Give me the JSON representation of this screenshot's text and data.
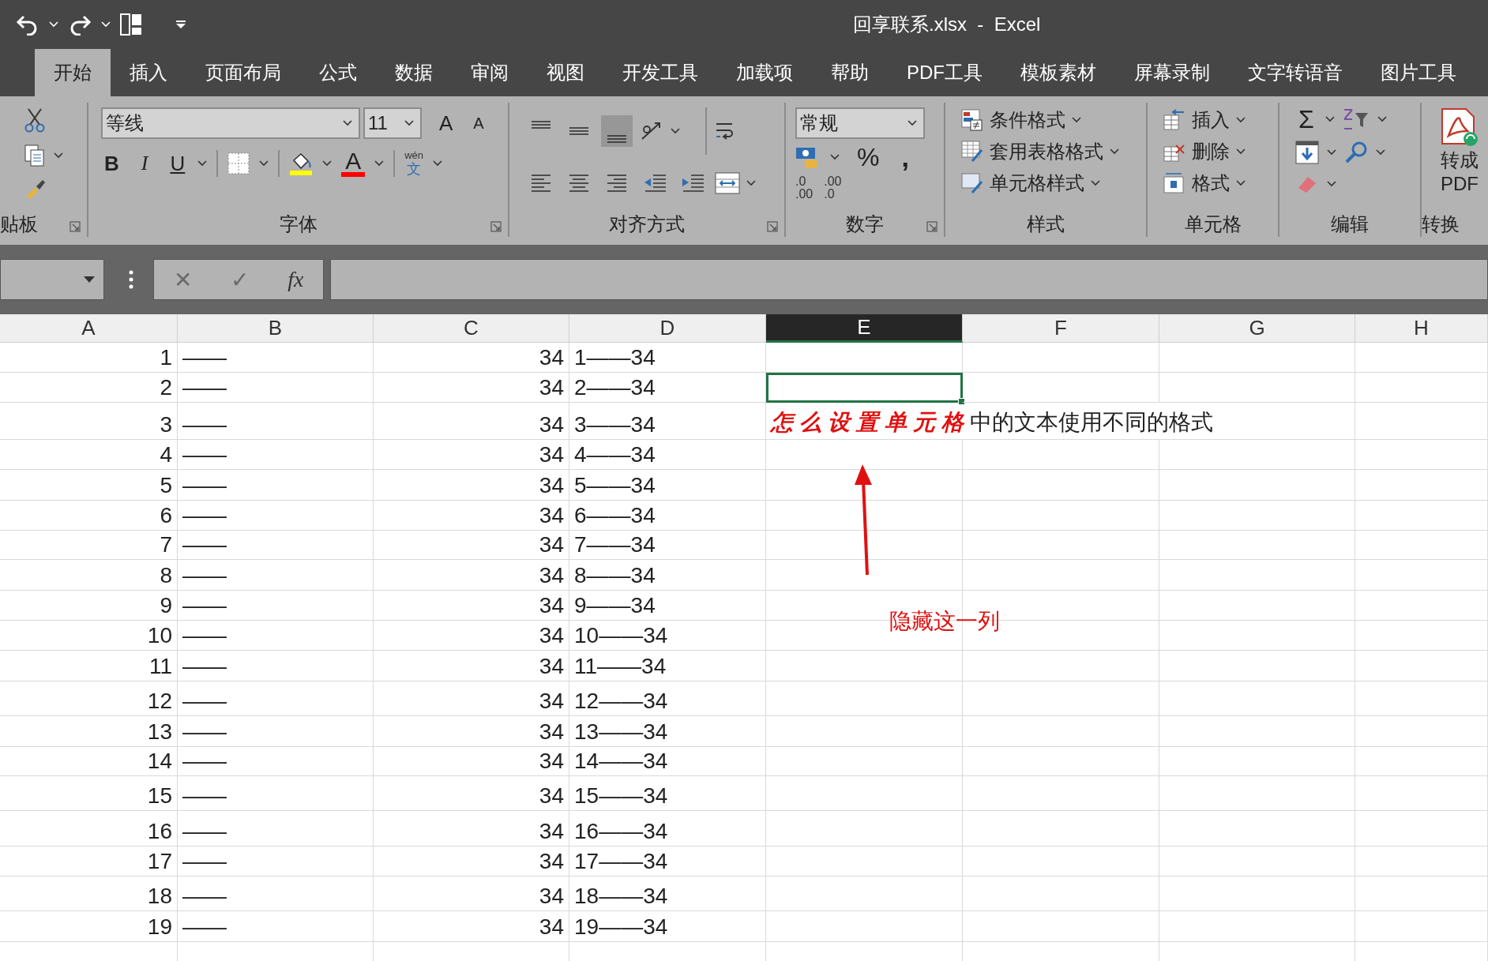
{
  "title_bar": {
    "title": "回享联系.xlsx  -  Excel"
  },
  "ribbon_tabs": [
    {
      "label": "开始",
      "selected": true
    },
    {
      "label": "插入",
      "selected": false
    },
    {
      "label": "页面布局",
      "selected": false
    },
    {
      "label": "公式",
      "selected": false
    },
    {
      "label": "数据",
      "selected": false
    },
    {
      "label": "审阅",
      "selected": false
    },
    {
      "label": "视图",
      "selected": false
    },
    {
      "label": "开发工具",
      "selected": false
    },
    {
      "label": "加载项",
      "selected": false
    },
    {
      "label": "帮助",
      "selected": false
    },
    {
      "label": "PDF工具",
      "selected": false
    },
    {
      "label": "模板素材",
      "selected": false
    },
    {
      "label": "屏幕录制",
      "selected": false
    },
    {
      "label": "文字转语音",
      "selected": false
    },
    {
      "label": "图片工具",
      "selected": false
    }
  ],
  "ribbon": {
    "clipboard": {
      "group_label": "贴板"
    },
    "font": {
      "font_name": "等线",
      "font_size": "11",
      "grow_glyph": "A",
      "shrink_glyph": "A",
      "bold_glyph": "B",
      "italic_glyph": "I",
      "underline_glyph": "U",
      "font_color_glyph": "A",
      "phonetic_top": "wén",
      "phonetic_bottom": "文",
      "group_label": "字体"
    },
    "alignment": {
      "group_label": "对齐方式"
    },
    "number": {
      "format": "常规",
      "percent_glyph": "%",
      "comma_glyph": ",",
      "increase_decimal": [
        ".0",
        ".00"
      ],
      "decrease_decimal": [
        ".00",
        ".0"
      ],
      "group_label": "数字"
    },
    "styles": {
      "items": [
        "条件格式",
        "套用表格格式",
        "单元格样式"
      ],
      "group_label": "样式"
    },
    "cells": {
      "items": [
        "插入",
        "删除",
        "格式"
      ],
      "group_label": "单元格"
    },
    "editing": {
      "sum_glyph": "Σ",
      "group_label": "编辑"
    },
    "convert": {
      "button_lines": [
        "转成",
        "PDF"
      ],
      "group_label": "转换"
    }
  },
  "formula_bar": {
    "cancel_glyph": "✕",
    "enter_glyph": "✓",
    "function_glyph": "fx"
  },
  "sheet": {
    "columns": [
      {
        "label": "A",
        "selected": false
      },
      {
        "label": "B",
        "selected": false
      },
      {
        "label": "C",
        "selected": false
      },
      {
        "label": "D",
        "selected": false
      },
      {
        "label": "E",
        "selected": true
      },
      {
        "label": "F",
        "selected": false
      },
      {
        "label": "G",
        "selected": false
      },
      {
        "label": "H",
        "selected": false
      }
    ],
    "rows": [
      {
        "a": "1",
        "b": "——",
        "c": "34",
        "d": "1——34",
        "e_selected": false
      },
      {
        "a": "2",
        "b": "——",
        "c": "34",
        "d": "2——34",
        "e_selected": true
      },
      {
        "a": "3",
        "b": "——",
        "c": "34",
        "d": "3——34",
        "e_selected": false,
        "e_text": {
          "emphasis": "怎么设置单元格",
          "rest": "中的文本使用不同的格式"
        }
      },
      {
        "a": "4",
        "b": "——",
        "c": "34",
        "d": "4——34",
        "e_selected": false
      },
      {
        "a": "5",
        "b": "——",
        "c": "34",
        "d": "5——34",
        "e_selected": false
      },
      {
        "a": "6",
        "b": "——",
        "c": "34",
        "d": "6——34",
        "e_selected": false
      },
      {
        "a": "7",
        "b": "——",
        "c": "34",
        "d": "7——34",
        "e_selected": false
      },
      {
        "a": "8",
        "b": "——",
        "c": "34",
        "d": "8——34",
        "e_selected": false
      },
      {
        "a": "9",
        "b": "——",
        "c": "34",
        "d": "9——34",
        "e_selected": false
      },
      {
        "a": "10",
        "b": "——",
        "c": "34",
        "d": "10——34",
        "e_selected": false
      },
      {
        "a": "11",
        "b": "——",
        "c": "34",
        "d": "11——34",
        "e_selected": false
      },
      {
        "a": "12",
        "b": "——",
        "c": "34",
        "d": "12——34",
        "e_selected": false
      },
      {
        "a": "13",
        "b": "——",
        "c": "34",
        "d": "13——34",
        "e_selected": false
      },
      {
        "a": "14",
        "b": "——",
        "c": "34",
        "d": "14——34",
        "e_selected": false
      },
      {
        "a": "15",
        "b": "——",
        "c": "34",
        "d": "15——34",
        "e_selected": false
      },
      {
        "a": "16",
        "b": "——",
        "c": "34",
        "d": "16——34",
        "e_selected": false
      },
      {
        "a": "17",
        "b": "——",
        "c": "34",
        "d": "17——34",
        "e_selected": false
      },
      {
        "a": "18",
        "b": "——",
        "c": "34",
        "d": "18——34",
        "e_selected": false
      },
      {
        "a": "19",
        "b": "——",
        "c": "34",
        "d": "19——34",
        "e_selected": false
      }
    ]
  },
  "annotation": {
    "text": "隐藏这一列"
  }
}
